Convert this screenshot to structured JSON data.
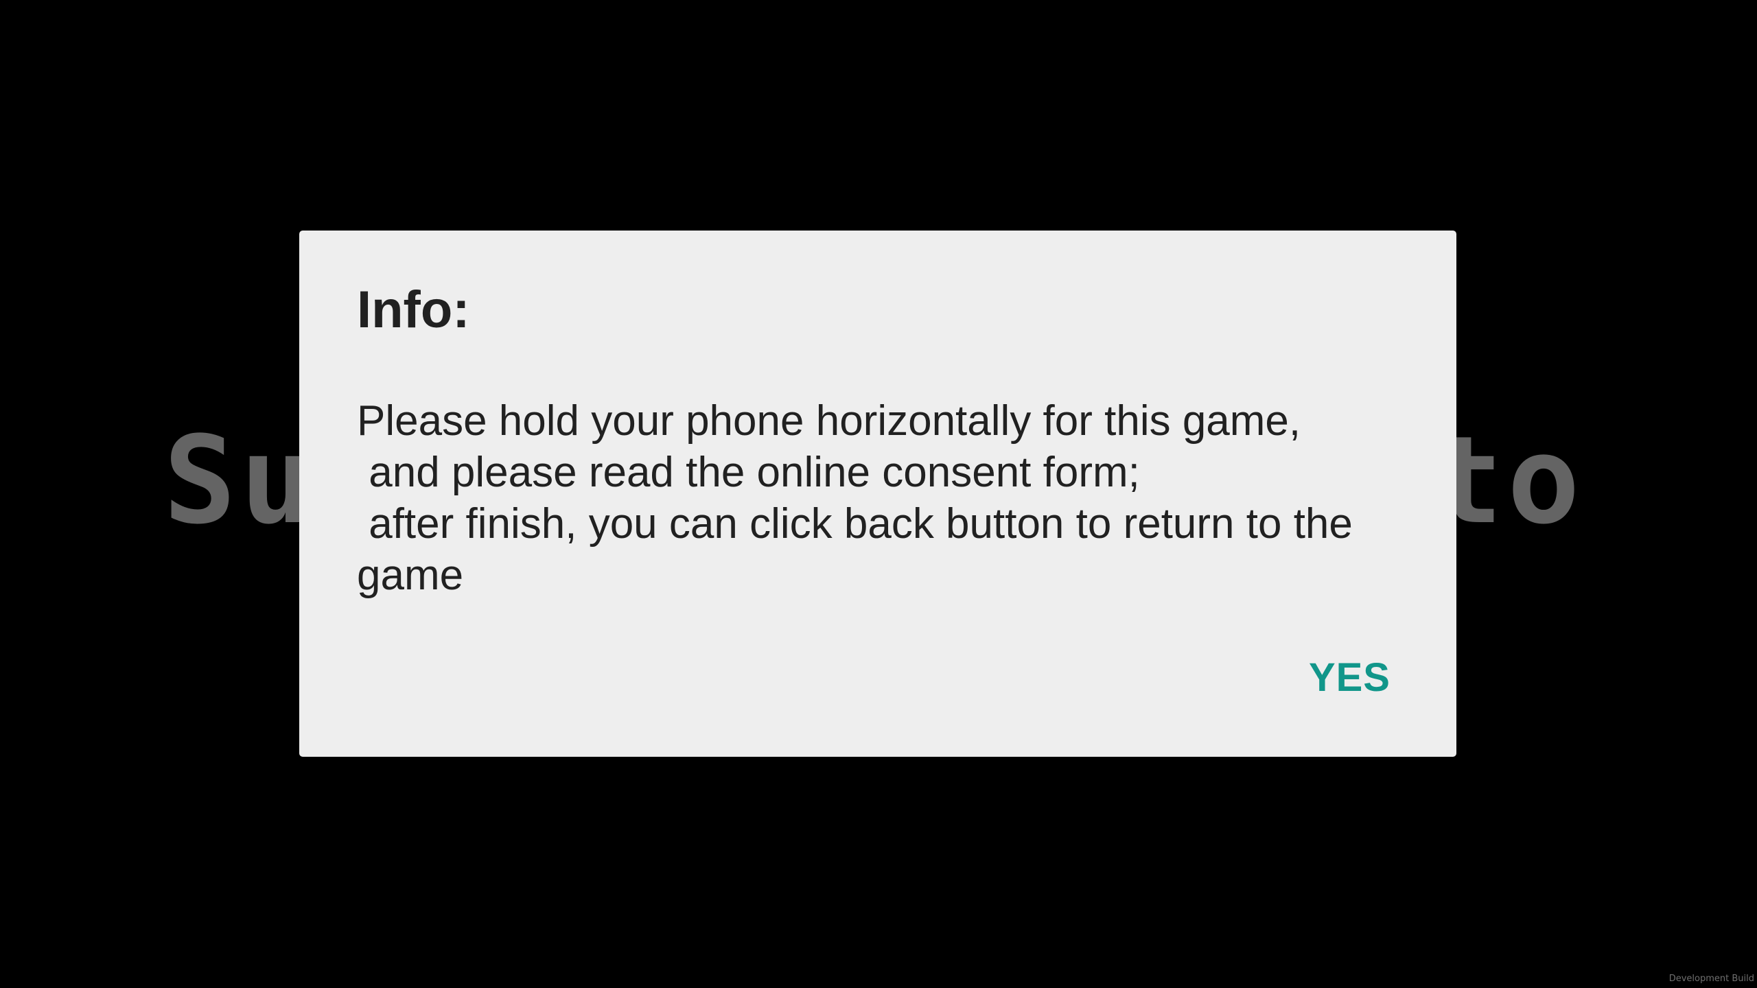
{
  "background_title": {
    "visible_left": "Su",
    "visible_right": "to"
  },
  "dialog": {
    "title": "Info:",
    "message_lines": [
      "Please hold your phone horizontally for this game,",
      " and please read the online consent form;",
      " after finish, you can click back button to return to the",
      "game"
    ],
    "confirm_label": "YES",
    "confirm_color": "#11968a",
    "background_color": "#eeeeee"
  },
  "footer": {
    "build_label": "Development Build"
  },
  "colors": {
    "screen_background": "#000000",
    "title_text": "#646464",
    "dialog_text": "#212121"
  }
}
